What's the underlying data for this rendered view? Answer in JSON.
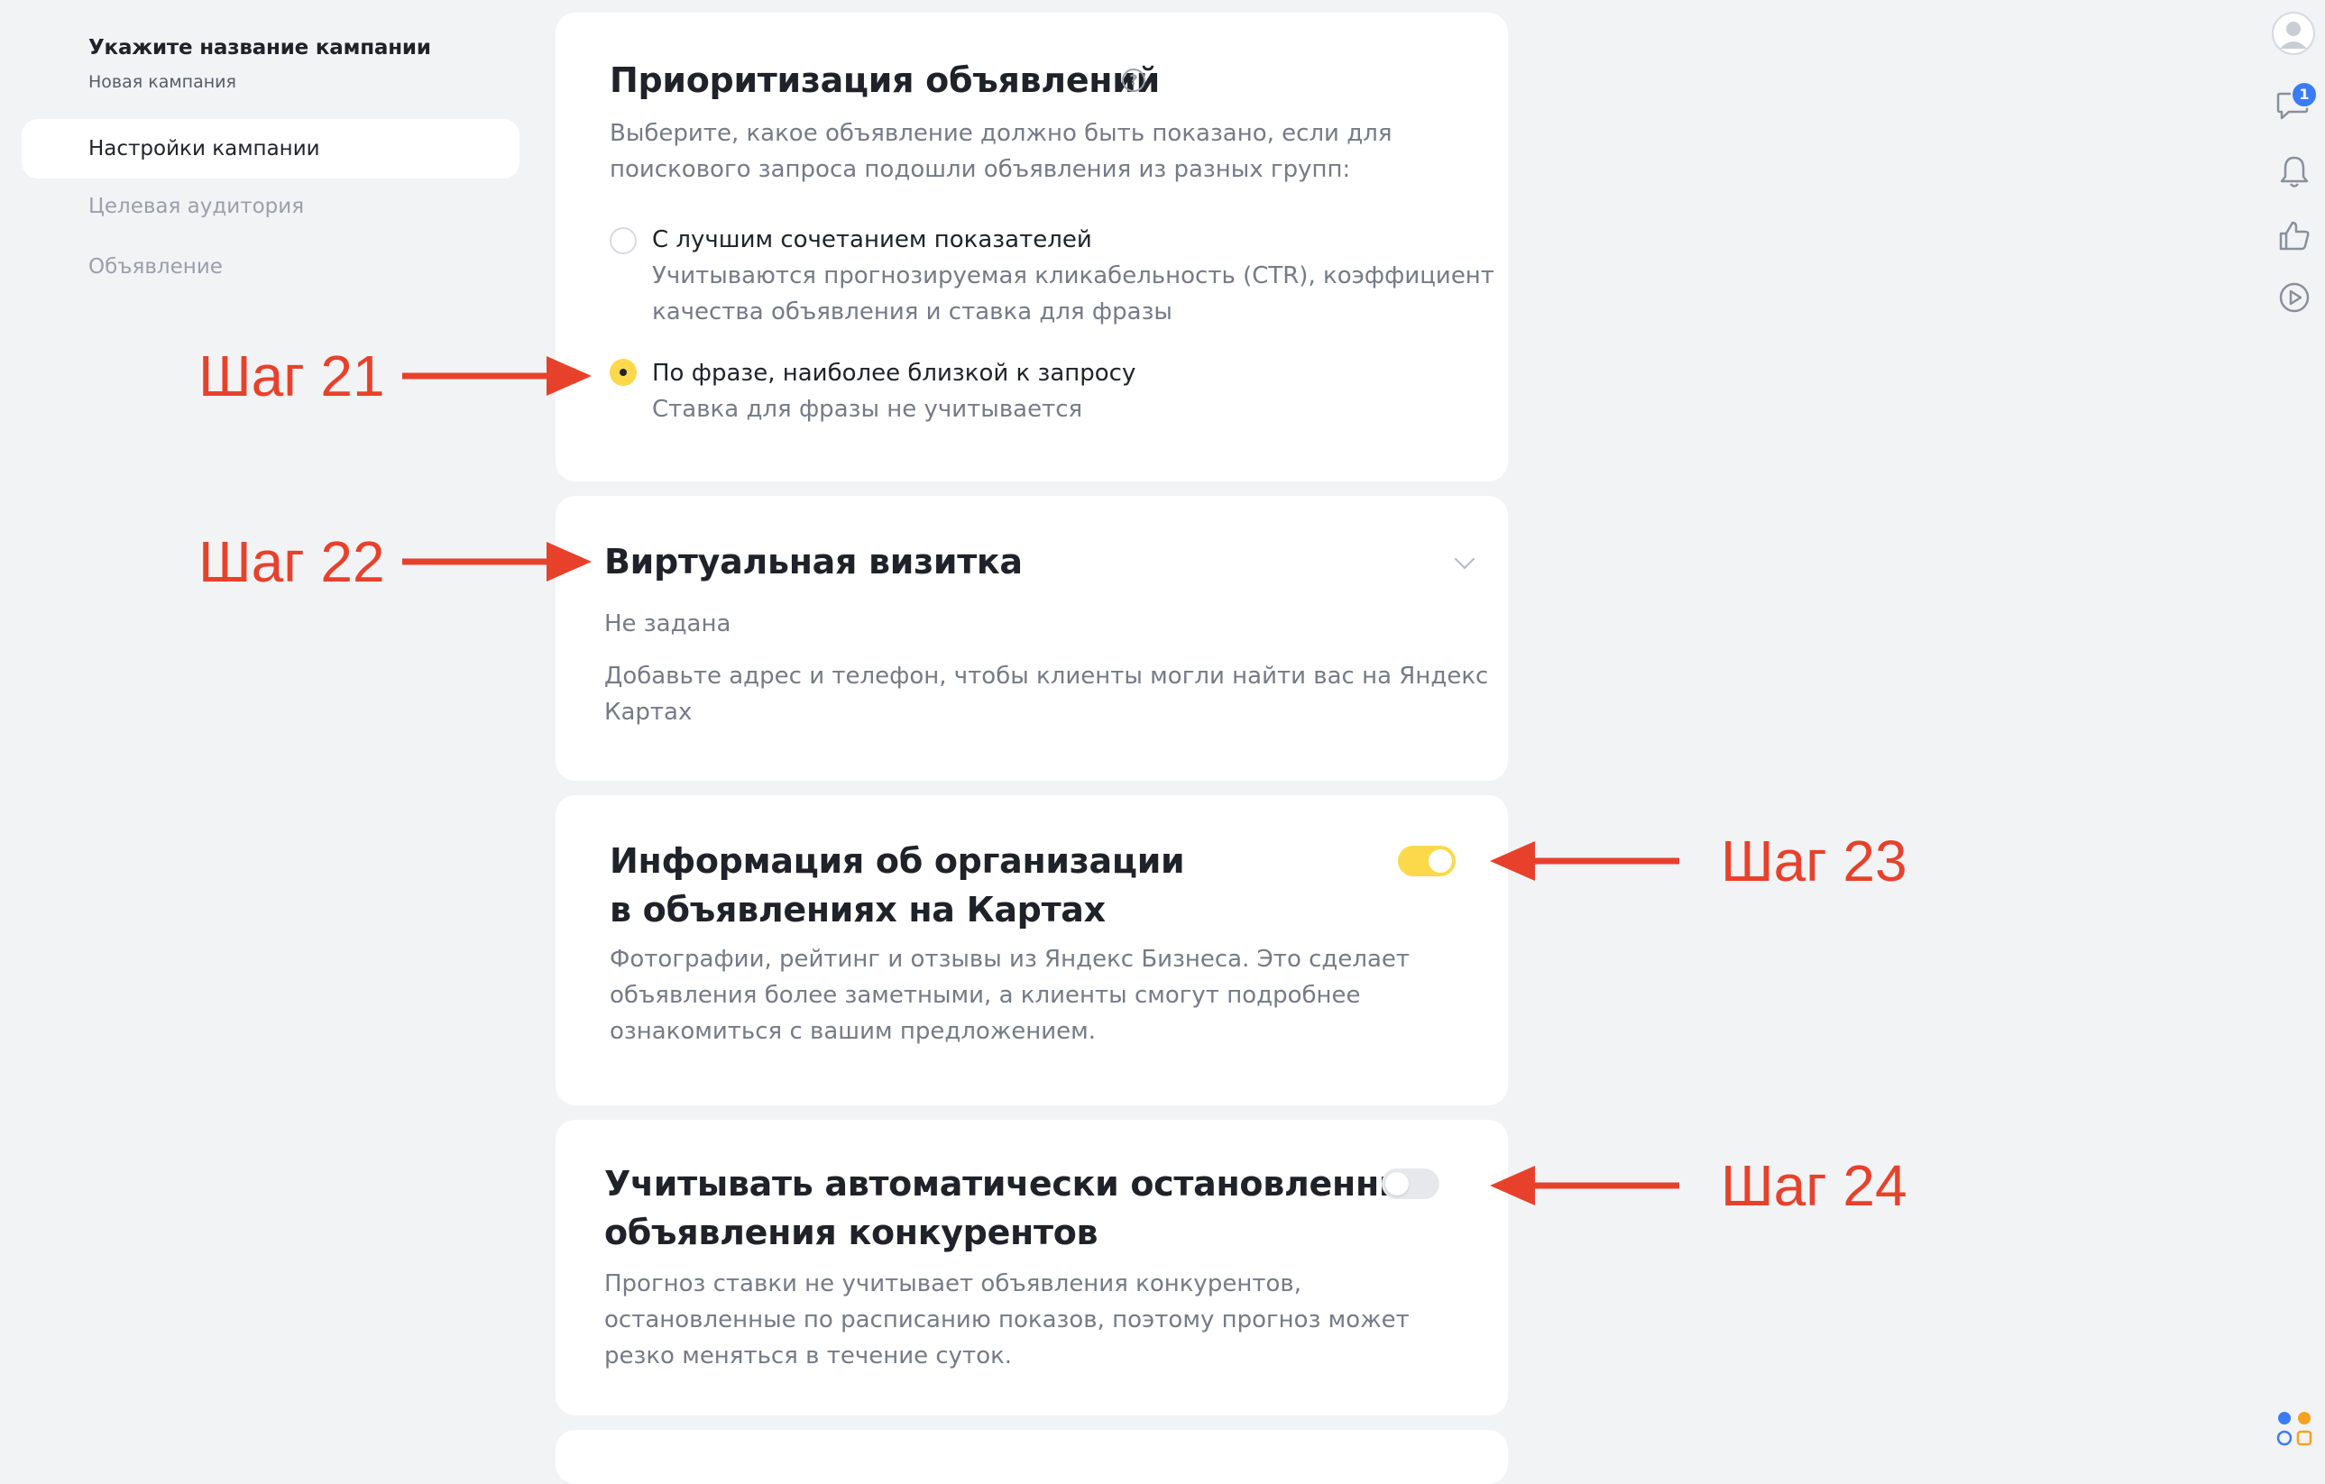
{
  "sidebar": {
    "campaign_title": "Укажите название кампании",
    "campaign_subtitle": "Новая кампания",
    "items": [
      {
        "label": "Настройки кампании",
        "active": true
      },
      {
        "label": "Целевая аудитория",
        "active": false
      },
      {
        "label": "Объявление",
        "active": false
      }
    ]
  },
  "prioritization": {
    "title": "Приоритизация объявлений",
    "help_icon": "question-circle-icon",
    "description_line1": "Выберите, какое объявление должно быть показано, если для",
    "description_line2": "поискового запроса подошли объявления из разных групп:",
    "options": [
      {
        "title": "С лучшим сочетанием показателей",
        "desc_line1": "Учитываются прогнозируемая кликабельность (CTR), коэффициент",
        "desc_line2": "качества объявления и ставка для фразы",
        "selected": false
      },
      {
        "title": "По фразе, наиболее близкой к запросу",
        "desc_line1": "Ставка для фразы не учитывается",
        "selected": true
      }
    ]
  },
  "vcard": {
    "title": "Виртуальная визитка",
    "status": "Не задана",
    "description_line1": "Добавьте адрес и телефон, чтобы клиенты могли найти вас на Яндекс",
    "description_line2": "Картах"
  },
  "org_info": {
    "title_line1": "Информация об организации",
    "title_line2": "в объявлениях на Картах",
    "enabled": true,
    "description_line1": "Фотографии, рейтинг и отзывы из Яндекс Бизнеса. Это сделает",
    "description_line2": "объявления более заметными, а клиенты смогут подробнее",
    "description_line3": "ознакомиться с вашим предложением."
  },
  "competitors": {
    "title_line1": "Учитывать автоматически остановленные",
    "title_line2": "объявления конкурентов",
    "enabled": false,
    "description_line1": "Прогноз ставки не учитывает объявления конкурентов,",
    "description_line2": "остановленные по расписанию показов, поэтому прогноз может",
    "description_line3": "резко меняться в течение суток."
  },
  "annotations": {
    "step21": "Шаг 21",
    "step22": "Шаг 22",
    "step23": "Шаг 23",
    "step24": "Шаг 24",
    "color": "#e8412b"
  },
  "right_rail": {
    "icons": [
      "avatar",
      "chat-icon",
      "bell-icon",
      "thumbs-up-icon",
      "play-icon"
    ],
    "chat_badge": "1"
  },
  "colors": {
    "accent_yellow": "#fbd94a",
    "background": "#f2f3f5",
    "card": "#ffffff",
    "badge_blue": "#3c7bf6"
  }
}
